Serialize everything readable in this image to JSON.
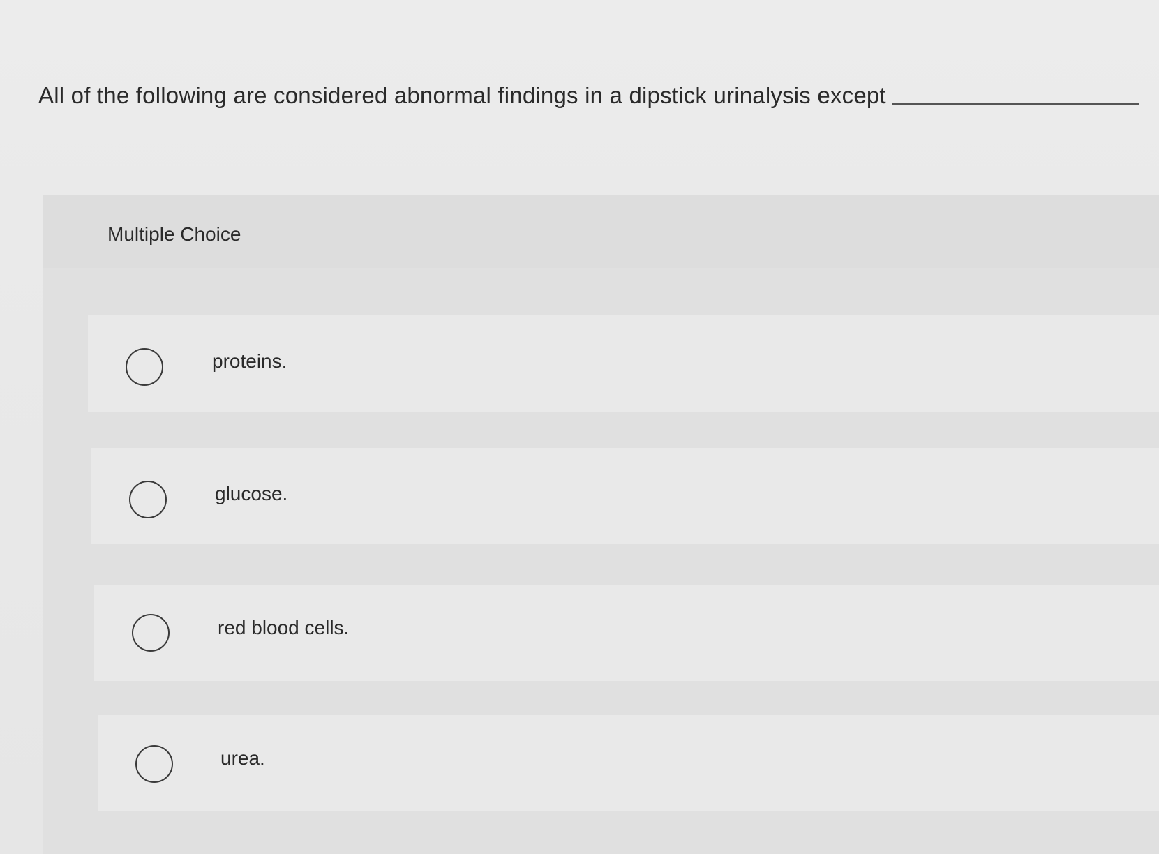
{
  "question": {
    "text": "All of the following are considered abnormal findings in a dipstick urinalysis except"
  },
  "multiple_choice": {
    "title": "Multiple Choice",
    "options": [
      {
        "label": "proteins."
      },
      {
        "label": "glucose."
      },
      {
        "label": "red blood cells."
      },
      {
        "label": "urea."
      }
    ]
  }
}
